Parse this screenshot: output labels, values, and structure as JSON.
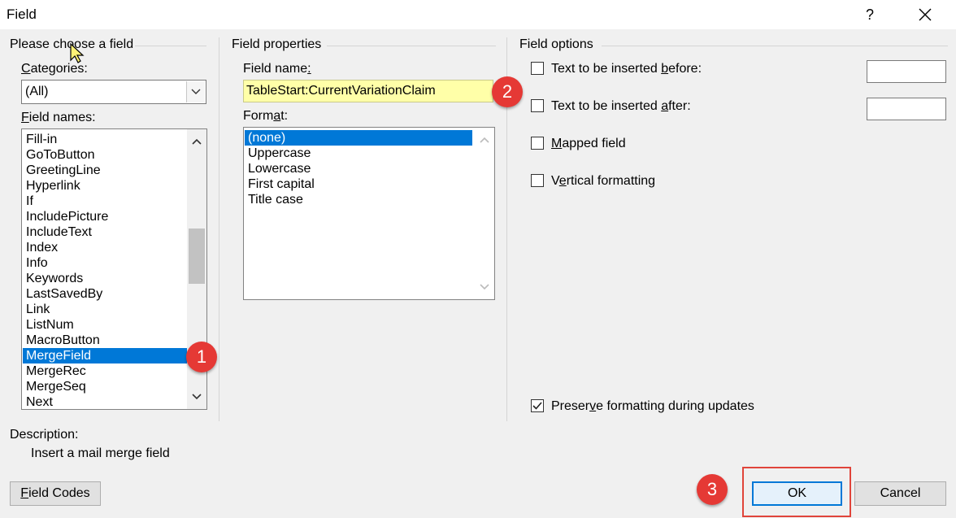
{
  "window": {
    "title": "Field",
    "help_label": "?"
  },
  "choose": {
    "group_title": "Please choose a field",
    "categories_label": "Categories:",
    "categories_value": "(All)",
    "field_names_label": "Field names:",
    "field_names": [
      "Fill-in",
      "GoToButton",
      "GreetingLine",
      "Hyperlink",
      "If",
      "IncludePicture",
      "IncludeText",
      "Index",
      "Info",
      "Keywords",
      "LastSavedBy",
      "Link",
      "ListNum",
      "MacroButton",
      "MergeField",
      "MergeRec",
      "MergeSeq",
      "Next"
    ],
    "selected_field": "MergeField"
  },
  "properties": {
    "group_title": "Field properties",
    "field_name_label": "Field name:",
    "field_name_value": "TableStart:CurrentVariationClaim",
    "format_label": "Format:",
    "formats": [
      "(none)",
      "Uppercase",
      "Lowercase",
      "First capital",
      "Title case"
    ],
    "selected_format": "(none)"
  },
  "options": {
    "group_title": "Field options",
    "text_before_label": "Text to be inserted before:",
    "text_after_label": "Text to be inserted after:",
    "mapped_label": "Mapped field",
    "vertical_label": "Vertical formatting",
    "preserve_label": "Preserve formatting during updates",
    "text_before_checked": false,
    "text_after_checked": false,
    "mapped_checked": false,
    "vertical_checked": false,
    "preserve_checked": true
  },
  "description": {
    "label": "Description:",
    "text": "Insert a mail merge field"
  },
  "buttons": {
    "field_codes": "Field Codes",
    "ok": "OK",
    "cancel": "Cancel"
  },
  "annotations": {
    "badge1": "1",
    "badge2": "2",
    "badge3": "3"
  },
  "colors": {
    "selection": "#0078d7",
    "highlight_field": "#ffffa8",
    "annotation_red": "#e53935"
  }
}
